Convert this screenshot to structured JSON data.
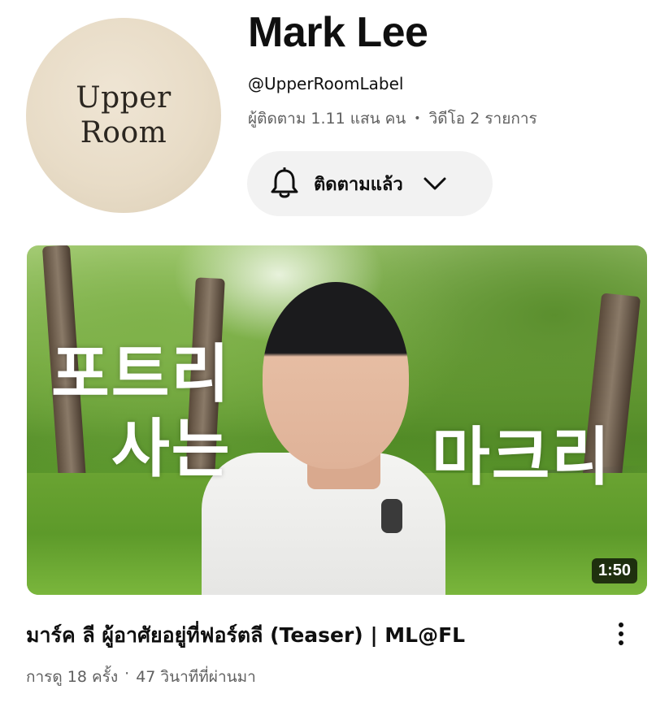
{
  "channel": {
    "avatar_logo_line1": "Upper",
    "avatar_logo_line2": "Room",
    "name": "Mark Lee",
    "handle": "@UpperRoomLabel",
    "subscribers": "ผู้ติดตาม 1.11 แสน คน",
    "meta_separator": "•",
    "video_count": "วิดีโอ 2 รายการ",
    "subscribe_button": {
      "label": "ติดตามแล้ว",
      "bell_icon": "bell-icon",
      "chevron_icon": "chevron-down-icon"
    }
  },
  "video": {
    "thumbnail_text": [
      "포트리",
      "사는",
      "마크리"
    ],
    "duration": "1:50",
    "title": "มาร์ค ลี ผู้อาศัยอยู่ที่ฟอร์ตลี (Teaser) | ML@FL",
    "views": "การดู 18 ครั้ง",
    "meta_separator": "·",
    "age": "47 วินาทีที่ผ่านมา",
    "more_icon": "more-vertical-icon"
  },
  "colors": {
    "primary_text": "#0f0f0f",
    "secondary_text": "#606060",
    "button_bg": "#f2f2f2",
    "avatar_bg": "#e8dcc7"
  }
}
